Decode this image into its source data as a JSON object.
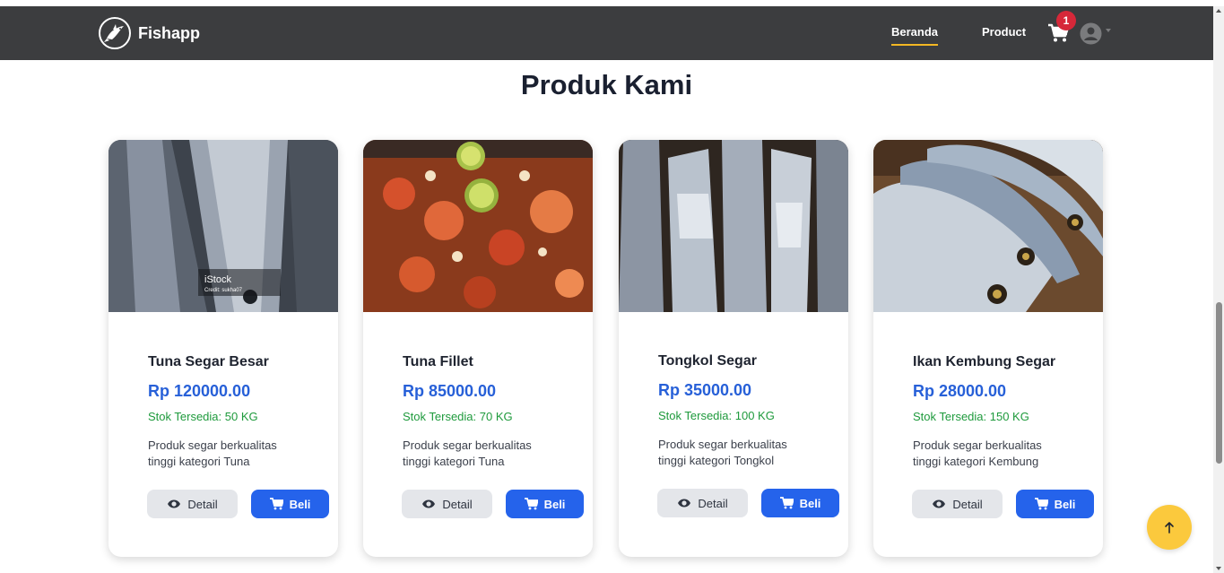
{
  "navbar": {
    "brand": "Fishapp",
    "links": [
      "Beranda",
      "Product"
    ],
    "cart_count": "1",
    "accent": "#f3b723"
  },
  "main": {
    "title": "Produk Kami"
  },
  "products": [
    {
      "name": "Tuna Segar Besar",
      "price": "Rp 120000.00",
      "stock": "Stok Tersedia: 50 KG",
      "desc": "Produk segar berkualitas tinggi kategori Tuna",
      "image_watermark": "iStock",
      "image_credit": "Credit: sukha07"
    },
    {
      "name": "Tuna Fillet",
      "price": "Rp 85000.00",
      "stock": "Stok Tersedia: 70 KG",
      "desc": "Produk segar berkualitas tinggi kategori Tuna"
    },
    {
      "name": "Tongkol Segar",
      "price": "Rp 35000.00",
      "stock": "Stok Tersedia: 100 KG",
      "desc": "Produk segar berkualitas tinggi kategori Tongkol"
    },
    {
      "name": "Ikan Kembung Segar",
      "price": "Rp 28000.00",
      "stock": "Stok Tersedia: 150 KG",
      "desc": "Produk segar berkualitas tinggi kategori Kembung"
    }
  ],
  "buttons": {
    "detail": "Detail",
    "buy": "Beli"
  },
  "colors": {
    "navbar_bg": "#3c3d3f",
    "price": "#2760d8",
    "stock": "#1e9a3c",
    "buy_button": "#2563eb",
    "badge": "#d62839",
    "fab": "#fbc93d"
  },
  "icons": [
    "fish-logo-icon",
    "cart-icon",
    "user-avatar-icon",
    "chevron-down-icon",
    "eye-icon",
    "cart-icon",
    "arrow-up-icon"
  ]
}
